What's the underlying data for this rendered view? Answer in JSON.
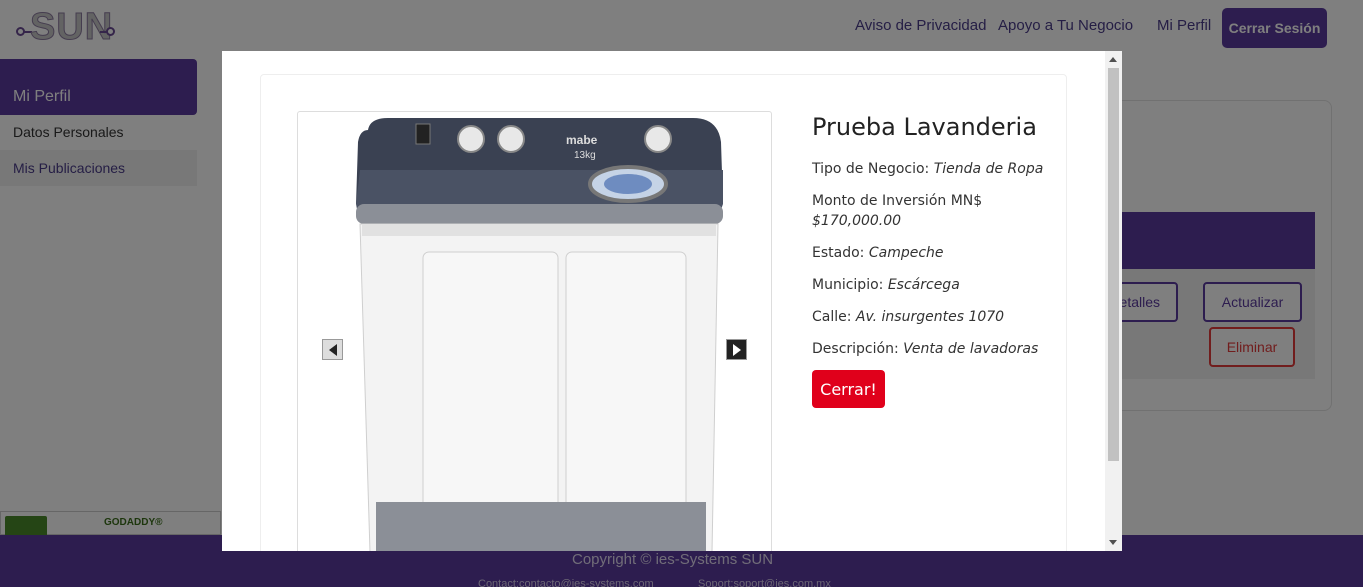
{
  "nav": {
    "logo_text": "SUN",
    "links": [
      "Aviso de Privacidad",
      "Apoyo a Tu Negocio",
      "Mi Perfil"
    ],
    "logout": "Cerrar Sesión"
  },
  "sidebar": {
    "title": "Mi Perfil",
    "items": [
      {
        "label": "Datos Personales"
      },
      {
        "label": "Mis Publicaciones"
      }
    ]
  },
  "card": {
    "details_button": "etalles",
    "update_button": "Actualizar",
    "delete_button": "Eliminar"
  },
  "badge": {
    "text": "GODADDY®"
  },
  "footer": {
    "copyright": "Copyright © ies-Systems SUN",
    "contact": "Contact:contacto@ies-systems.com",
    "support": "Soport:soport@ies.com.mx"
  },
  "modal": {
    "title": "Prueba Lavanderia",
    "fields": [
      {
        "label": "Tipo de Negocio:",
        "value": "Tienda de Ropa"
      },
      {
        "label": "Monto de Inversión MN$",
        "value": "$170,000.00"
      },
      {
        "label": "Estado:",
        "value": "Campeche"
      },
      {
        "label": "Municipio:",
        "value": "Escárcega"
      },
      {
        "label": "Calle:",
        "value": "Av. insurgentes 1070"
      },
      {
        "label": "Descripción:",
        "value": "Venta de lavadoras"
      }
    ],
    "close_button": "Cerrar!",
    "image": {
      "brand": "mabe",
      "capacity": "13kg"
    }
  },
  "colors": {
    "brand_purple": "#5b3a9e",
    "danger_red": "#e0001b",
    "link_purple": "#4b3c8a"
  }
}
